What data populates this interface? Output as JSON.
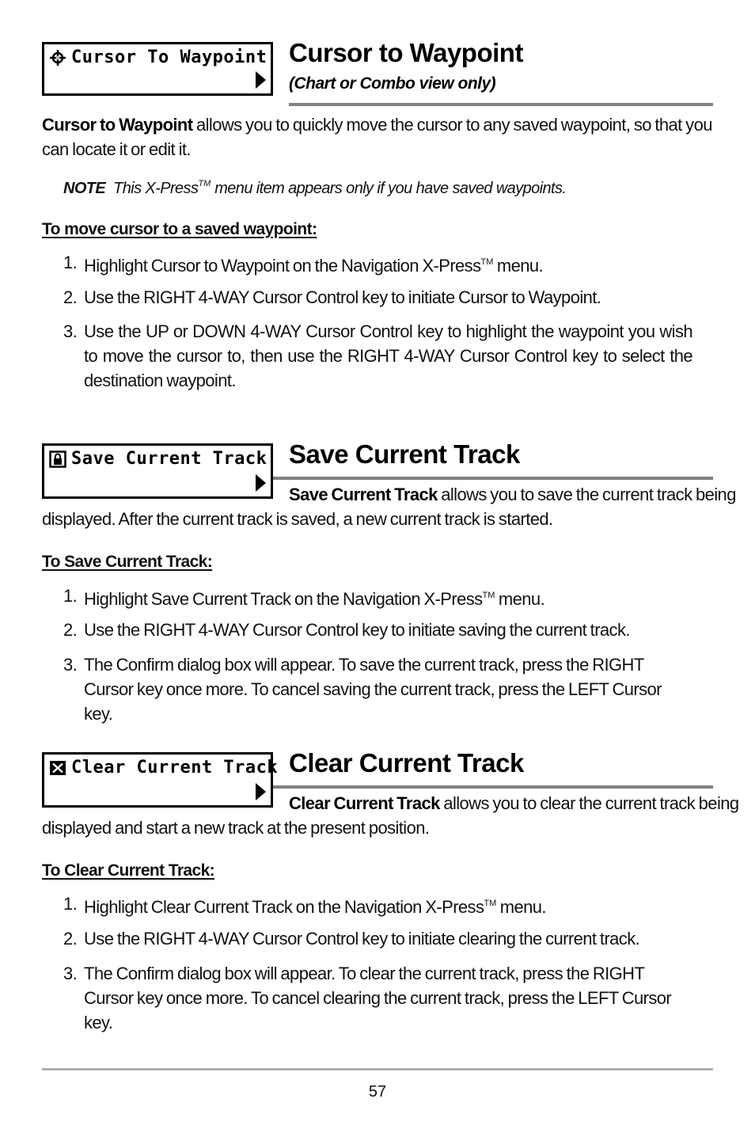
{
  "sections": [
    {
      "menu_box": {
        "label": "Cursor To Waypoint",
        "icon": "crosshair-icon",
        "arrow": "right-arrow-icon"
      },
      "title": "Cursor to Waypoint",
      "subtitle": "(Chart or Combo view only)",
      "intro_bold": "Cursor to Waypoint",
      "intro_rest": " allows you to quickly move the cursor to any saved waypoint, so that you can locate it or edit it.",
      "note_label": "NOTE",
      "note_text_before_tm": "This X-Press",
      "note_tm": "TM",
      "note_text_after_tm": " menu item appears only if you have saved waypoints.",
      "procedure_heading": "To move cursor to a saved waypoint:",
      "steps": [
        {
          "num": "1.",
          "before_tm": "Highlight Cursor to Waypoint on the Navigation X-Press",
          "tm": "TM",
          "after_tm": " menu."
        },
        {
          "num": "2.",
          "text": "Use the RIGHT 4-WAY Cursor Control key to initiate Cursor to Waypoint."
        },
        {
          "num": "3.",
          "text": "Use the UP or DOWN 4-WAY Cursor Control key to highlight the waypoint you wish to move the cursor to, then use the RIGHT 4-WAY Cursor Control key to select the destination waypoint."
        }
      ]
    },
    {
      "menu_box": {
        "label": "Save Current Track",
        "icon": "lock-icon",
        "arrow": "right-arrow-icon"
      },
      "title": "Save Current Track",
      "intro_bold": "Save Current Track",
      "intro_rest_line1": " allows you to save the current track being",
      "intro_rest_line2": "displayed. After the current track is saved, a new current track is started.",
      "procedure_heading": "To Save Current Track:",
      "steps": [
        {
          "num": "1.",
          "before_tm": "Highlight Save Current Track on the Navigation X-Press",
          "tm": "TM",
          "after_tm": " menu."
        },
        {
          "num": "2.",
          "text": "Use the RIGHT 4-WAY Cursor Control key to initiate saving the current track."
        },
        {
          "num": "3.",
          "text": "The Confirm dialog box will appear. To save the current track,  press the RIGHT Cursor key once more. To cancel saving the current track, press the LEFT Cursor key."
        }
      ]
    },
    {
      "menu_box": {
        "label": "Clear Current Track",
        "icon": "clear-x-icon",
        "arrow": "right-arrow-icon"
      },
      "title": "Clear Current Track",
      "intro_bold": "Clear Current Track",
      "intro_rest_line1": " allows you to clear the current track being",
      "intro_rest_line2": "displayed and start a new track at the present position.",
      "procedure_heading": "To Clear Current Track:",
      "steps": [
        {
          "num": "1.",
          "before_tm": "Highlight Clear Current Track on the Navigation X-Press",
          "tm": "TM",
          "after_tm": " menu."
        },
        {
          "num": "2.",
          "text": "Use the RIGHT 4-WAY Cursor Control key to initiate clearing the current track."
        },
        {
          "num": "3.",
          "text": "The Confirm dialog box will appear. To clear the current track,  press the RIGHT Cursor key once more. To cancel clearing the current track, press the LEFT Cursor key."
        }
      ]
    }
  ],
  "footer": {
    "page_number": "57"
  }
}
